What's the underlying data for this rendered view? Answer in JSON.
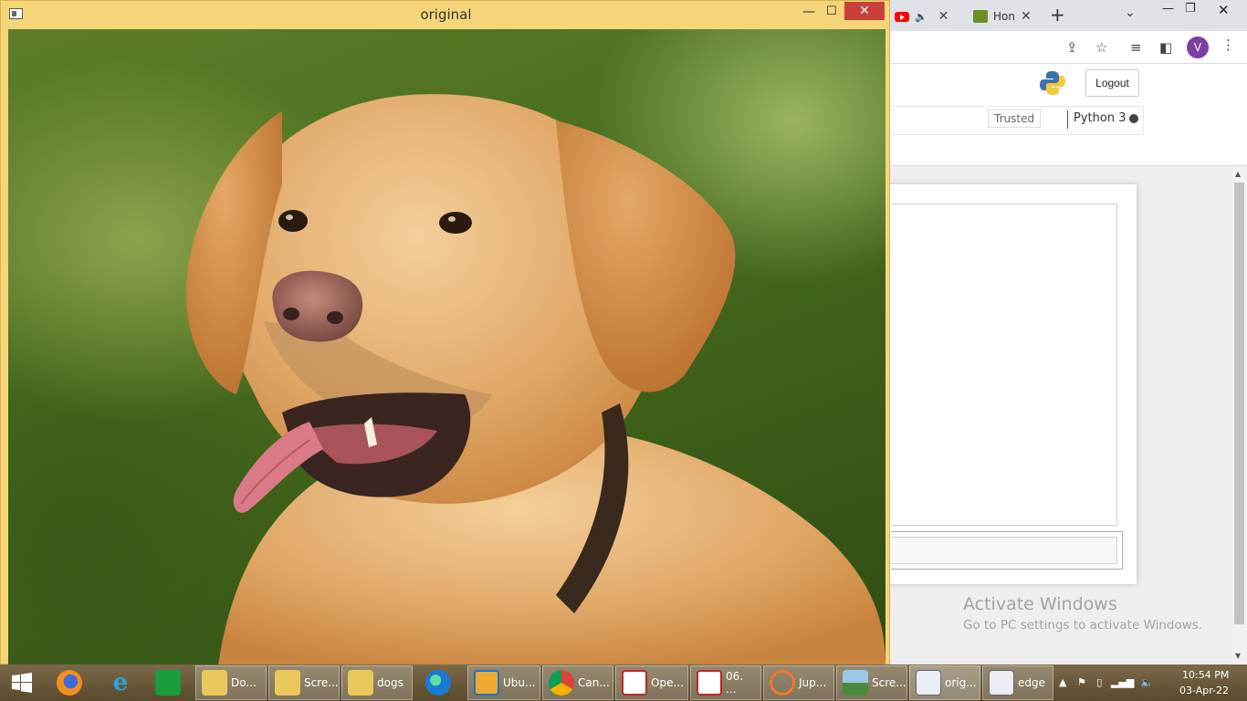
{
  "browser": {
    "tabs": [
      {
        "label": "",
        "icon": "youtube-icon",
        "audio": true
      },
      {
        "label": "Hon",
        "icon": "home-favicon"
      }
    ],
    "profile_initial": "V"
  },
  "jupyter": {
    "logout_label": "Logout",
    "trusted_label": "Trusted",
    "kernel_name": "Python 3"
  },
  "watermark": {
    "title": "Activate Windows",
    "subtitle": "Go to PC settings to activate Windows."
  },
  "image_window": {
    "title": "original",
    "content": "photo of a golden labrador retriever with tongue out on a green blurred background"
  },
  "taskbar": {
    "items": [
      {
        "label": "",
        "icon": "windows-start-icon"
      },
      {
        "label": "",
        "icon": "firefox-icon"
      },
      {
        "label": "",
        "icon": "internet-explorer-icon"
      },
      {
        "label": "",
        "icon": "store-icon"
      },
      {
        "label": "Do...",
        "icon": "downloads-folder-icon"
      },
      {
        "label": "Scre...",
        "icon": "folder-icon"
      },
      {
        "label": "dogs",
        "icon": "folder-icon"
      },
      {
        "label": "",
        "icon": "edge-icon"
      },
      {
        "label": "Ubu...",
        "icon": "ubuntu-icon"
      },
      {
        "label": "Can...",
        "icon": "chrome-icon"
      },
      {
        "label": "Ope...",
        "icon": "pdf-icon"
      },
      {
        "label": "06. ...",
        "icon": "pdf-icon"
      },
      {
        "label": "Jup...",
        "icon": "jupyter-icon"
      },
      {
        "label": "Scre...",
        "icon": "photos-icon"
      },
      {
        "label": "orig...",
        "icon": "image-window-icon"
      },
      {
        "label": "edge",
        "icon": "image-window-icon"
      }
    ],
    "clock_time": "10:54 PM",
    "clock_date": "03-Apr-22"
  },
  "colors": {
    "window_frame": "#f6d57a",
    "close_button": "#c7403a",
    "taskbar": "#6a5a3a",
    "profile": "#7b3fa0"
  }
}
